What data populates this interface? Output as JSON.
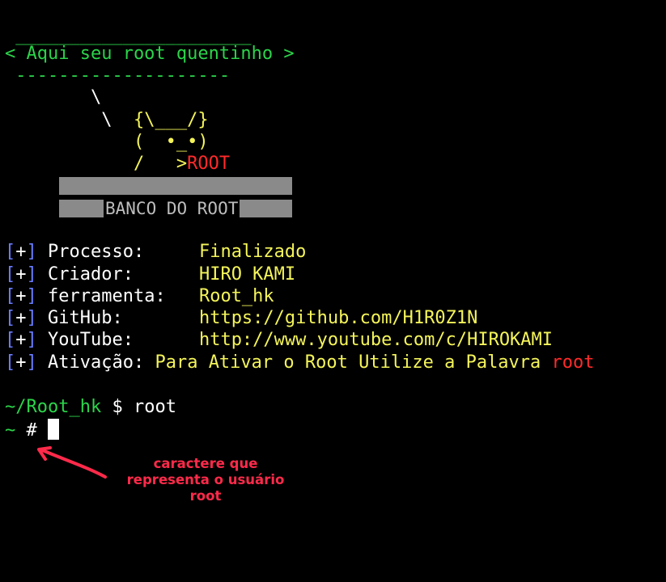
{
  "banner": {
    "top_rule": " ______________________",
    "speech": "< Aqui seu root quentinho >",
    "bottom_rule": " --------------------",
    "art_line1": "        \\",
    "art_line2": "         \\  {\\___/}",
    "art_line3": "            (  •_•)",
    "art_line4_prefix": "            /   >",
    "art_root": "ROOT",
    "bank_label": "BANCO DO ROOT"
  },
  "info": [
    {
      "bracket_open": "[",
      "plus": "+",
      "bracket_close": "]",
      "key": "Processo:   ",
      "value": "Finalizado"
    },
    {
      "bracket_open": "[",
      "plus": "+",
      "bracket_close": "]",
      "key": "Criador:    ",
      "value": "HIRO KAMI"
    },
    {
      "bracket_open": "[",
      "plus": "+",
      "bracket_close": "]",
      "key": "ferramenta: ",
      "value": "Root_hk"
    },
    {
      "bracket_open": "[",
      "plus": "+",
      "bracket_close": "]",
      "key": "GitHub:     ",
      "value": "https://github.com/H1R0Z1N"
    },
    {
      "bracket_open": "[",
      "plus": "+",
      "bracket_close": "]",
      "key": "YouTube:    ",
      "value": "http://www.youtube.com/c/HIROKAMI"
    }
  ],
  "activation": {
    "bracket_open": "[",
    "plus": "+",
    "bracket_close": "]",
    "key": "Ativação:",
    "value": " Para Ativar o Root Utilize a Palavra ",
    "keyword": "root"
  },
  "prompt1": {
    "path": "~/Root_hk",
    "symbol": " $ ",
    "command": "root"
  },
  "prompt2": {
    "path": "~",
    "symbol": " # "
  },
  "annotation": {
    "line1": "caractere que",
    "line2": "representa o usuário",
    "line3": "root"
  },
  "colors": {
    "green": "#2bd44a",
    "yellow": "#f4f45a",
    "red": "#ff2a2a",
    "blue": "#6a7dff",
    "annotation": "#ff2a4a"
  }
}
